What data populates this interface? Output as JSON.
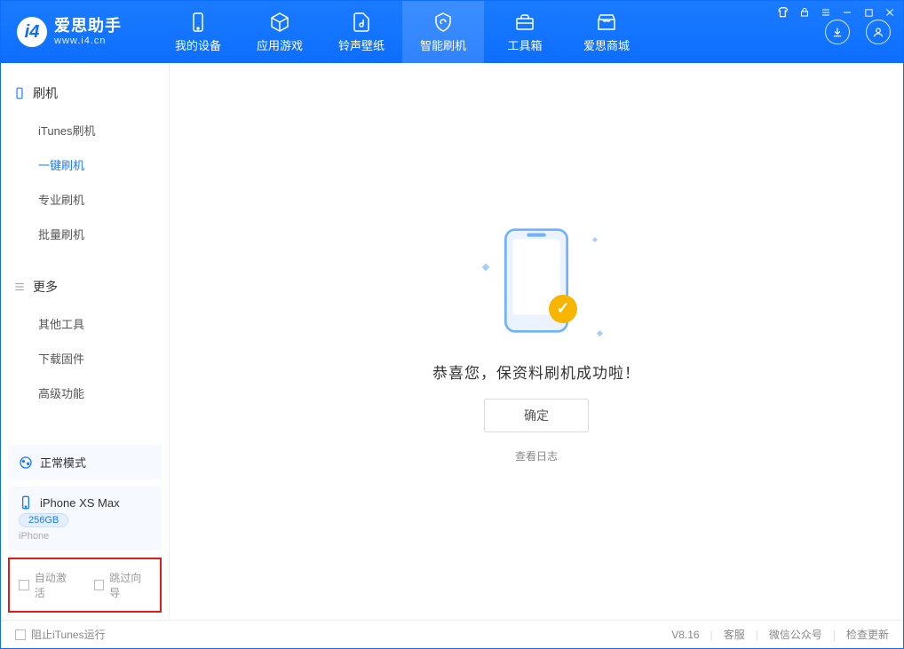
{
  "app": {
    "name": "爱思助手",
    "url": "www.i4.cn"
  },
  "nav": {
    "items": [
      {
        "label": "我的设备"
      },
      {
        "label": "应用游戏"
      },
      {
        "label": "铃声壁纸"
      },
      {
        "label": "智能刷机"
      },
      {
        "label": "工具箱"
      },
      {
        "label": "爱思商城"
      }
    ]
  },
  "sidebar": {
    "sec1_title": "刷机",
    "sec1_items": [
      "iTunes刷机",
      "一键刷机",
      "专业刷机",
      "批量刷机"
    ],
    "sec2_title": "更多",
    "sec2_items": [
      "其他工具",
      "下载固件",
      "高级功能"
    ],
    "mode_card": "正常模式",
    "device_card": {
      "name": "iPhone XS Max",
      "capacity": "256GB",
      "type": "iPhone"
    }
  },
  "options": {
    "auto_activate": "自动激活",
    "skip_guide": "跳过向导"
  },
  "main": {
    "success_text": "恭喜您，保资料刷机成功啦！",
    "ok_button": "确定",
    "view_log": "查看日志"
  },
  "footer": {
    "block_itunes": "阻止iTunes运行",
    "version": "V8.16",
    "link_service": "客服",
    "link_wechat": "微信公众号",
    "link_update": "检查更新"
  }
}
